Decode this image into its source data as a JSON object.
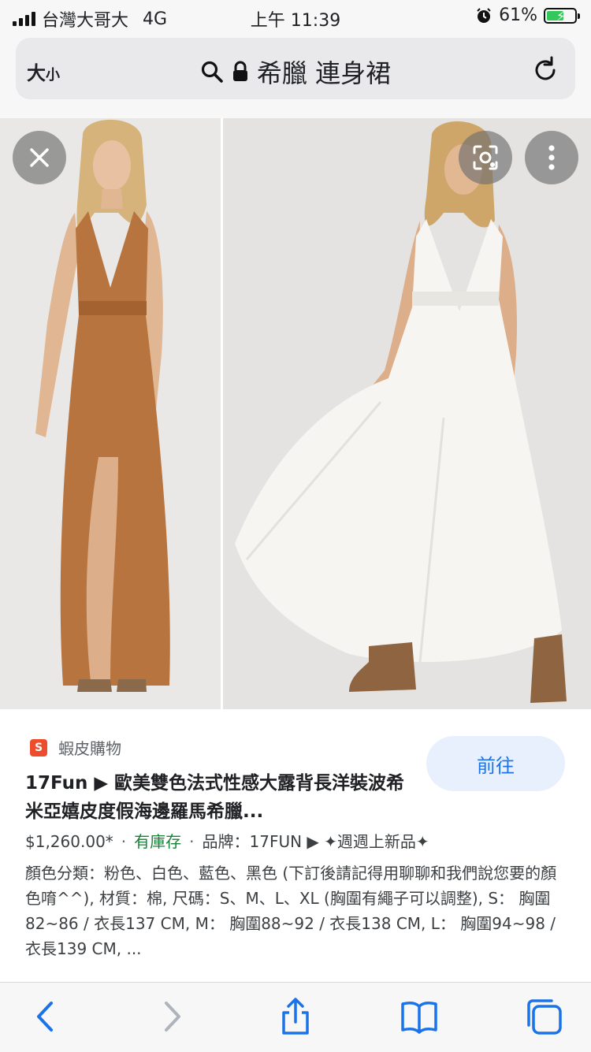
{
  "status_bar": {
    "carrier": "台灣大哥大",
    "network": "4G",
    "time": "上午 11:39",
    "battery_percent": "61%",
    "battery_level": 0.61
  },
  "address_bar": {
    "text_size_big": "大",
    "text_size_small": "小",
    "query": "希臘 連身裙"
  },
  "image_viewer": {
    "close_icon": "close-icon",
    "lens_icon": "lens-icon",
    "more_icon": "more-vert-icon"
  },
  "result": {
    "source_badge": "S",
    "source": "蝦皮購物",
    "go_label": "前往",
    "title": "17Fun ▶ 歐美雙色法式性感大露背長洋裝波希米亞嬉皮度假海邊羅馬希臘...",
    "price": "$1,260.00*",
    "stock": "有庫存",
    "brand": "品牌：17FUN ▶ ✦週週上新品✦",
    "description": "顏色分類：粉色、白色、藍色、黑色 (下訂後請記得用聊聊和我們說您要的顏色唷^^), 材質：棉, 尺碼：S、M、L、XL (胸圍有繩子可以調整), S： 胸圍82~86 / 衣長137 CM, M： 胸圍88~92 / 衣長138 CM, L： 胸圍94~98 / 衣長139 CM, ..."
  },
  "colors": {
    "accent": "#1a73e8",
    "go_button_bg": "#e8f0fe",
    "stock_green": "#188038",
    "dress_rust": "#b8743f",
    "dress_white": "#f6f5f2"
  }
}
